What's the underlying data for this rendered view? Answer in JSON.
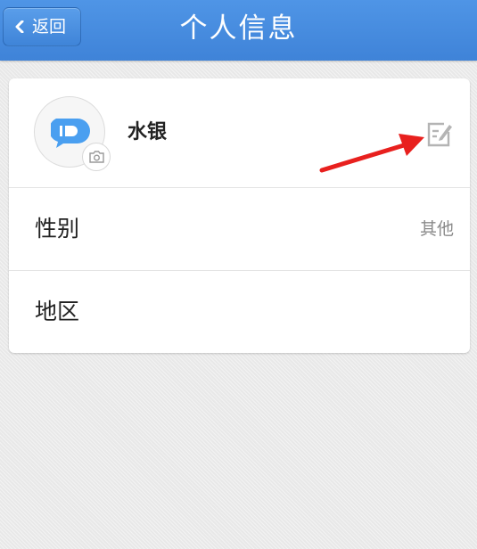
{
  "header": {
    "back_label": "返回",
    "title": "个人信息"
  },
  "profile": {
    "username": "水银",
    "icons": {
      "avatar": "bullet-avatar-icon",
      "camera": "camera-icon",
      "edit": "edit-icon",
      "back": "chevron-left-icon"
    }
  },
  "rows": [
    {
      "label": "性别",
      "value": "其他"
    },
    {
      "label": "地区",
      "value": ""
    }
  ],
  "colors": {
    "header_bg": "#4a8fe2",
    "avatar_blue": "#4a9ff0",
    "annotation_red": "#e8201e"
  }
}
